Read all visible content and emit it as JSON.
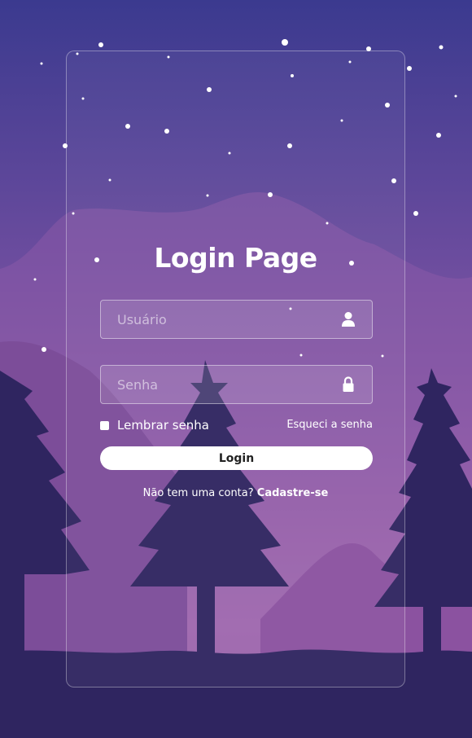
{
  "login": {
    "title": "Login Page",
    "username_placeholder": "Usuário",
    "password_placeholder": "Senha",
    "remember_label": "Lembrar senha",
    "forgot_label": "Esqueci a senha",
    "login_button": "Login",
    "signup_prompt": "Não tem uma conta?",
    "signup_link": "Cadastre-se"
  },
  "icons": {
    "username": "user-icon",
    "password": "lock-icon"
  },
  "colors": {
    "sky_top": "#3b3a8f",
    "sky_bottom": "#b97bb6",
    "trees": "#2f2560",
    "button_bg": "#ffffff",
    "text": "#ffffff"
  }
}
